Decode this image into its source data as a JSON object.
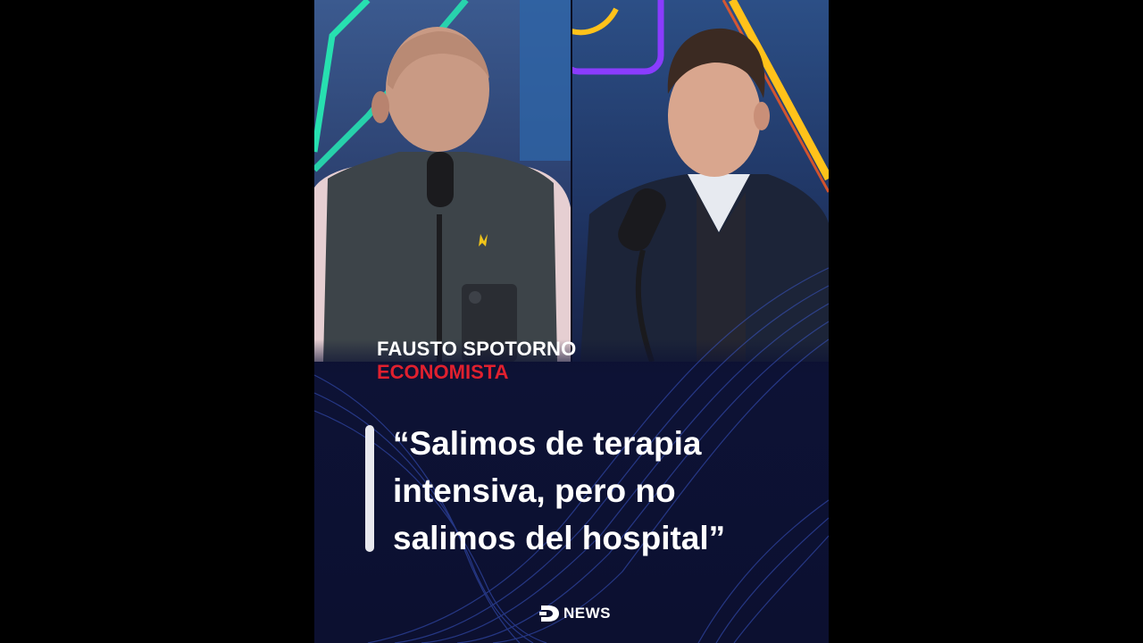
{
  "lower_third": {
    "name": "FAUSTO SPOTORNO",
    "role": "ECONOMISTA"
  },
  "quote": {
    "lines": [
      "“Salimos de terapia",
      "intensiva, pero no",
      "salimos del hospital”"
    ]
  },
  "logo": {
    "text": "NEWS",
    "icon": "d-news-logo-icon"
  },
  "colors": {
    "background": "#0c1030",
    "role_accent": "#e0202e",
    "neon_green": "#27e0b0",
    "neon_yellow": "#ffc21a",
    "neon_purple": "#8a3cff"
  }
}
